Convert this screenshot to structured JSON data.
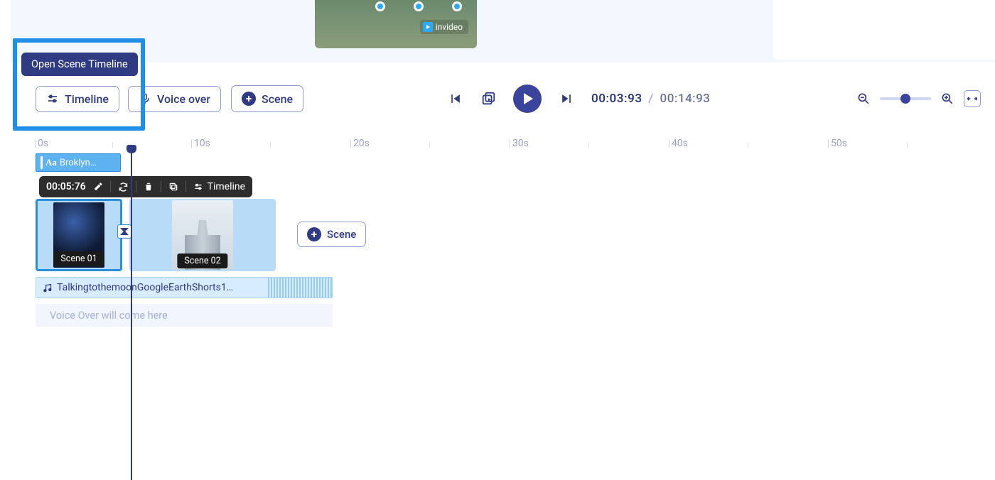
{
  "tooltip": {
    "text": "Open Scene Timeline"
  },
  "toolbar": {
    "timeline_label": "Timeline",
    "voiceover_label": "Voice over",
    "scene_label": "Scene"
  },
  "preview": {
    "watermark": "invideo"
  },
  "transport": {
    "current_time": "00:03:93",
    "duration": "00:14:93"
  },
  "zoom": {
    "handle_percent": 40
  },
  "ruler": {
    "ticks": [
      "0s",
      "10s",
      "20s",
      "30s",
      "40s",
      "50s"
    ]
  },
  "text_clip": {
    "prefix": "Aa",
    "label": "Broklyn…"
  },
  "clip_tools": {
    "timecode": "00:05:76",
    "timeline_label": "Timeline"
  },
  "scenes": [
    {
      "label": "Scene 01"
    },
    {
      "label": "Scene 02"
    }
  ],
  "add_scene_inline": {
    "label": "Scene"
  },
  "audio": {
    "label": "TalkingtothemoonGoogleEarthShorts1…"
  },
  "voiceover_placeholder": {
    "label": "Voice Over will come here"
  }
}
